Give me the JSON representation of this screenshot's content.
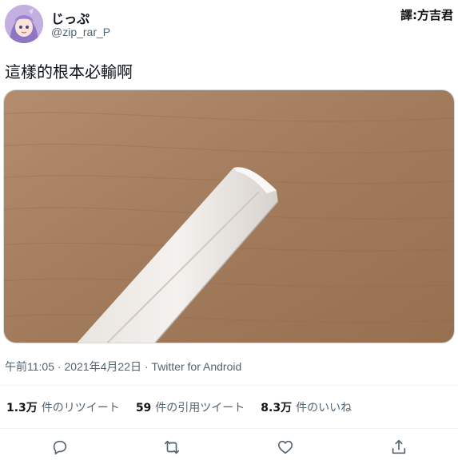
{
  "author": {
    "display_name": "じっぷ",
    "handle": "@zip_rar_P"
  },
  "translator_badge": "譯:方吉君",
  "tweet": {
    "text": "這樣的根本必輸啊"
  },
  "meta": {
    "time": "午前11:05",
    "date": "2021年4月22日",
    "source": "Twitter for Android",
    "separator": "·"
  },
  "stats": [
    {
      "count": "1.3万",
      "label": "件のリツイート"
    },
    {
      "count": "59",
      "label": "件の引用ツイート"
    },
    {
      "count": "8.3万",
      "label": "件のいいね"
    }
  ],
  "actions": [
    "reply-icon",
    "retweet-icon",
    "like-icon",
    "share-icon"
  ],
  "colors": {
    "secondary_text": "#536471",
    "divider": "#eff3f4",
    "primary_text": "#0f1419"
  }
}
